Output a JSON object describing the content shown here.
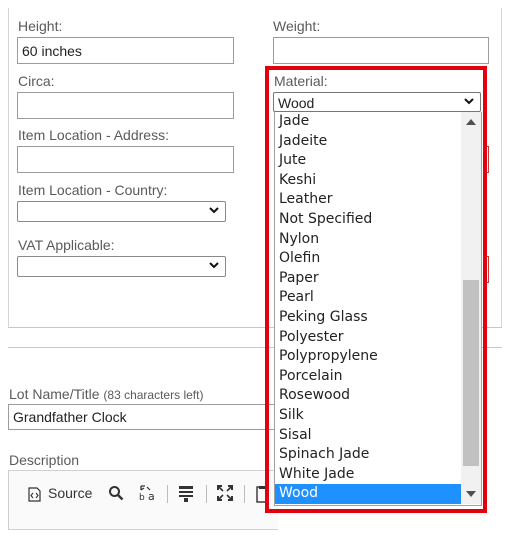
{
  "form": {
    "height_label": "Height:",
    "height_value": "60 inches",
    "weight_label": "Weight:",
    "weight_value": "",
    "circa_label": "Circa:",
    "circa_value": "",
    "material_label": "Material:",
    "location_address_label": "Item Location - Address:",
    "location_address_value": "",
    "location_country_label": "Item Location - Country:",
    "location_country_value": "",
    "vat_label": "VAT Applicable:",
    "vat_value": "",
    "lot_name_label": "Lot Name/Title",
    "lot_name_hint": "(83 characters left)",
    "lot_name_value": "Grandfather Clock",
    "description_label": "Description"
  },
  "material_dropdown": {
    "selected": "Wood",
    "options": [
      "Jade",
      "Jadeite",
      "Jute",
      "Keshi",
      "Leather",
      "Not Specified",
      "Nylon",
      "Olefin",
      "Paper",
      "Pearl",
      "Peking Glass",
      "Polyester",
      "Polypropylene",
      "Porcelain",
      "Rosewood",
      "Silk",
      "Sisal",
      "Spinach Jade",
      "White Jade",
      "Wood"
    ],
    "highlight_color": "#e2000f",
    "selected_option_color": "#1e90ff"
  },
  "editor_toolbar": {
    "source_label": "Source"
  },
  "icons": [
    "source-icon",
    "find-icon",
    "replace-icon",
    "block-icon",
    "maximize-icon",
    "paste-icon",
    "chevron-down-icon",
    "scroll-up-arrow-icon",
    "scroll-down-arrow-icon"
  ]
}
